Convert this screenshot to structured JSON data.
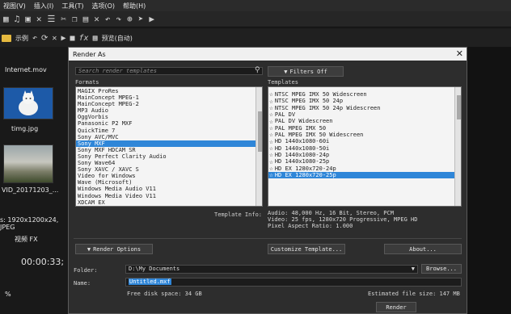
{
  "app": {
    "menu": [
      "视图(V)",
      "插入(I)",
      "工具(T)",
      "选项(O)",
      "帮助(H)"
    ],
    "toolbar2_label_example": "示例",
    "toolbar2_preview": "预览(自动)",
    "library": {
      "file1": "Internet.mov",
      "file2": "timg.jpg",
      "file3": "VID_20171203_...",
      "media_info": "s: 1920x1200x24, JPEG",
      "tab_label": "视频 FX",
      "timecode": "00:00:33;",
      "percent": "%"
    }
  },
  "dialog": {
    "title": "Render As",
    "close_label": "✕",
    "search_placeholder": "Search render templates",
    "filters_label": "Filters Off",
    "formats_label": "Formats",
    "templates_label": "Templates",
    "formats": [
      "MAGIX ProRes",
      "MainConcept MPEG-1",
      "MainConcept MPEG-2",
      "MP3 Audio",
      "OggVorbis",
      "Panasonic P2 MXF",
      "QuickTime 7",
      "Sony AVC/MVC",
      "Sony MXF",
      "Sony MXF HDCAM SR",
      "Sony Perfect Clarity Audio",
      "Sony Wave64",
      "Sony XAVC / XAVC S",
      "Video for Windows",
      "Wave (Microsoft)",
      "Windows Media Audio V11",
      "Windows Media Video V11",
      "XDCAM EX"
    ],
    "formats_selected_index": 8,
    "templates": [
      "NTSC MPEG IMX 50 Widescreen",
      "NTSC MPEG IMX 50 24p",
      "NTSC MPEG IMX 50 24p Widescreen",
      "PAL DV",
      "PAL DV Widescreen",
      "PAL MPEG IMX 50",
      "PAL MPEG IMX 50 Widescreen",
      "HD 1440x1080-60i",
      "HD 1440x1080-50i",
      "HD 1440x1080-24p",
      "HD 1440x1080-25p",
      "HD EX 1280x720-24p",
      "HD EX 1280x720-25p"
    ],
    "templates_selected_index": 12,
    "template_info_label": "Template Info:",
    "template_info": "Audio: 48,000 Hz, 16 Bit, Stereo, PCM\nVideo: 25 fps, 1280x720 Progressive, MPEG HD\nPixel Aspect Ratio: 1.000",
    "render_options_label": "Render Options",
    "customize_label": "Customize Template...",
    "about_label": "About...",
    "folder_label": "Folder:",
    "folder_value": "D:\\My Documents",
    "browse_label": "Browse...",
    "name_label": "Name:",
    "name_value": "Untitled.mxf",
    "free_disk": "Free disk space: 34 GB",
    "estimated_size": "Estimated file size: 147 MB",
    "render_label": "Render"
  },
  "colors": {
    "selection": "#2f86d8",
    "dialog_bg": "#2d2d2d",
    "title_bg": "#f0f0f0"
  }
}
